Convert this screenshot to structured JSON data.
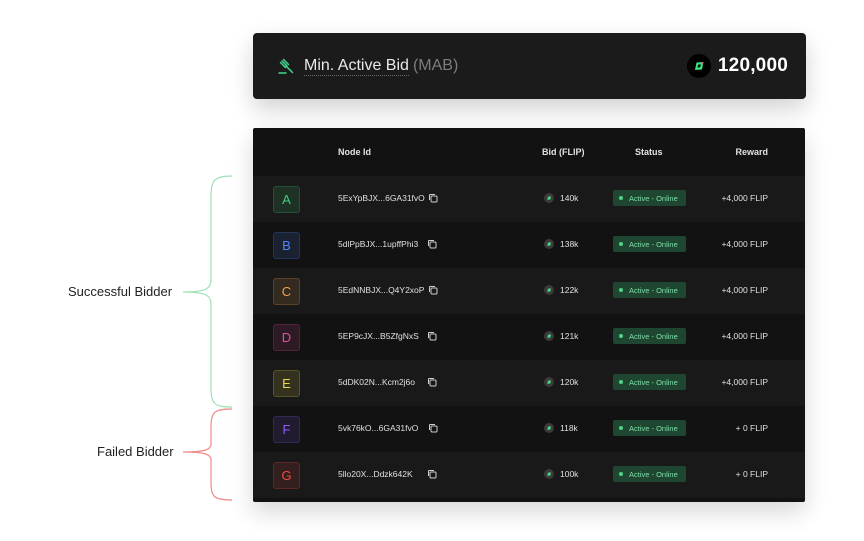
{
  "mab": {
    "title": "Min. Active Bid",
    "abbr": "(MAB)",
    "value": "120,000"
  },
  "table": {
    "headers": {
      "node_id": "Node Id",
      "bid": "Bid (FLIP)",
      "status": "Status",
      "reward": "Reward"
    },
    "rows": [
      {
        "letter": "A",
        "node": "5ExYpBJX...6GA31fvO",
        "bid": "140k",
        "status": "Active - Online",
        "reward": "+4,000 FLIP",
        "color": "#3ecf7b"
      },
      {
        "letter": "B",
        "node": "5dlPpBJX...1upffPhi3",
        "bid": "138k",
        "status": "Active - Online",
        "reward": "+4,000 FLIP",
        "color": "#4f86ff"
      },
      {
        "letter": "C",
        "node": "5EdNNBJX...Q4Y2xoP",
        "bid": "122k",
        "status": "Active - Online",
        "reward": "+4,000 FLIP",
        "color": "#f0a04b"
      },
      {
        "letter": "D",
        "node": "5EP9cJX...B5ZfgNxS",
        "bid": "121k",
        "status": "Active - Online",
        "reward": "+4,000 FLIP",
        "color": "#e0529c"
      },
      {
        "letter": "E",
        "node": "5dDK02N...Kcm2j6o",
        "bid": "120k",
        "status": "Active - Online",
        "reward": "+4,000 FLIP",
        "color": "#e6d84a"
      },
      {
        "letter": "F",
        "node": "5vk76kO...6GA31fvO",
        "bid": "118k",
        "status": "Active - Online",
        "reward": "+ 0 FLIP",
        "color": "#8a5cf6"
      },
      {
        "letter": "G",
        "node": "5llo20X...Ddzk642K",
        "bid": "100k",
        "status": "Active - Online",
        "reward": "+ 0 FLIP",
        "color": "#ee4b45"
      }
    ]
  },
  "annotations": {
    "successful": "Successful Bidder",
    "failed": "Failed Bidder",
    "successful_color": "#9fe0b6",
    "failed_color": "#ef8a86"
  },
  "icons": {
    "mab": "gavel-icon",
    "token": "flip-coin-icon",
    "copy": "copy-icon",
    "status": "status-dot-icon"
  }
}
